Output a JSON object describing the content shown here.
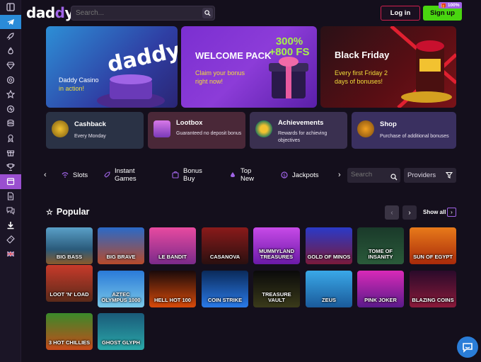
{
  "header": {
    "logo": "daddy",
    "search_placeholder": "Search...",
    "login_label": "Log in",
    "signup_label": "Sign up",
    "bonus_tag": "100%"
  },
  "sidebar": {
    "items": [
      "sidebar-toggle-icon",
      "telegram-icon",
      "rocket-icon",
      "fire-icon",
      "diamond-icon",
      "chip-icon",
      "star-icon",
      "live-icon",
      "coins-icon",
      "ribbon-icon",
      "gift-icon",
      "trophy-icon",
      "calendar-icon",
      "document-icon",
      "chat-icon",
      "download-icon",
      "ticket-icon",
      "flag-uk-icon"
    ]
  },
  "banners": [
    {
      "title": "Daddy Casino",
      "subtitle": "in action!"
    },
    {
      "title": "WELCOME PACK",
      "bonus": "300% +800 FS",
      "subtitle": "Claim your bonus right now!"
    },
    {
      "title": "Black Friday",
      "subtitle": "Every first Friday 2 days of bonuses!"
    }
  ],
  "promos": [
    {
      "title": "Cashback",
      "desc": "Every Monday"
    },
    {
      "title": "Lootbox",
      "desc": "Guaranteed no deposit bonus"
    },
    {
      "title": "Achievements",
      "desc": "Rewards for achieving objectives"
    },
    {
      "title": "Shop",
      "desc": "Purchase of additional bonuses"
    }
  ],
  "categories": [
    "Slots",
    "Instant Games",
    "Bonus Buy",
    "Top New",
    "Jackpots"
  ],
  "filters": {
    "search_placeholder": "Search",
    "providers_label": "Providers"
  },
  "popular": {
    "title": "Popular",
    "show_all": "Show all",
    "games": [
      "BIG BASS",
      "BIG BRAVE",
      "LE BANDIT",
      "CASANOVA",
      "MUMMYLAND TREASURES",
      "GOLD OF MINOS",
      "TOME OF INSANITY",
      "SUN OF EGYPT",
      "LOOT 'N' LOAD",
      "AZTEC OLYMPUS 1000",
      "HELL HOT 100",
      "COIN STRIKE",
      "TREASURE VAULT",
      "ZEUS",
      "PINK JOKER",
      "BLAZING COINS",
      "3 HOT CHILLIES",
      "GHOST GLYPH"
    ]
  },
  "colors": {
    "accent": "#a064e6",
    "signup": "#49d610",
    "login_border": "#d0204e",
    "bg": "#140f1c"
  }
}
